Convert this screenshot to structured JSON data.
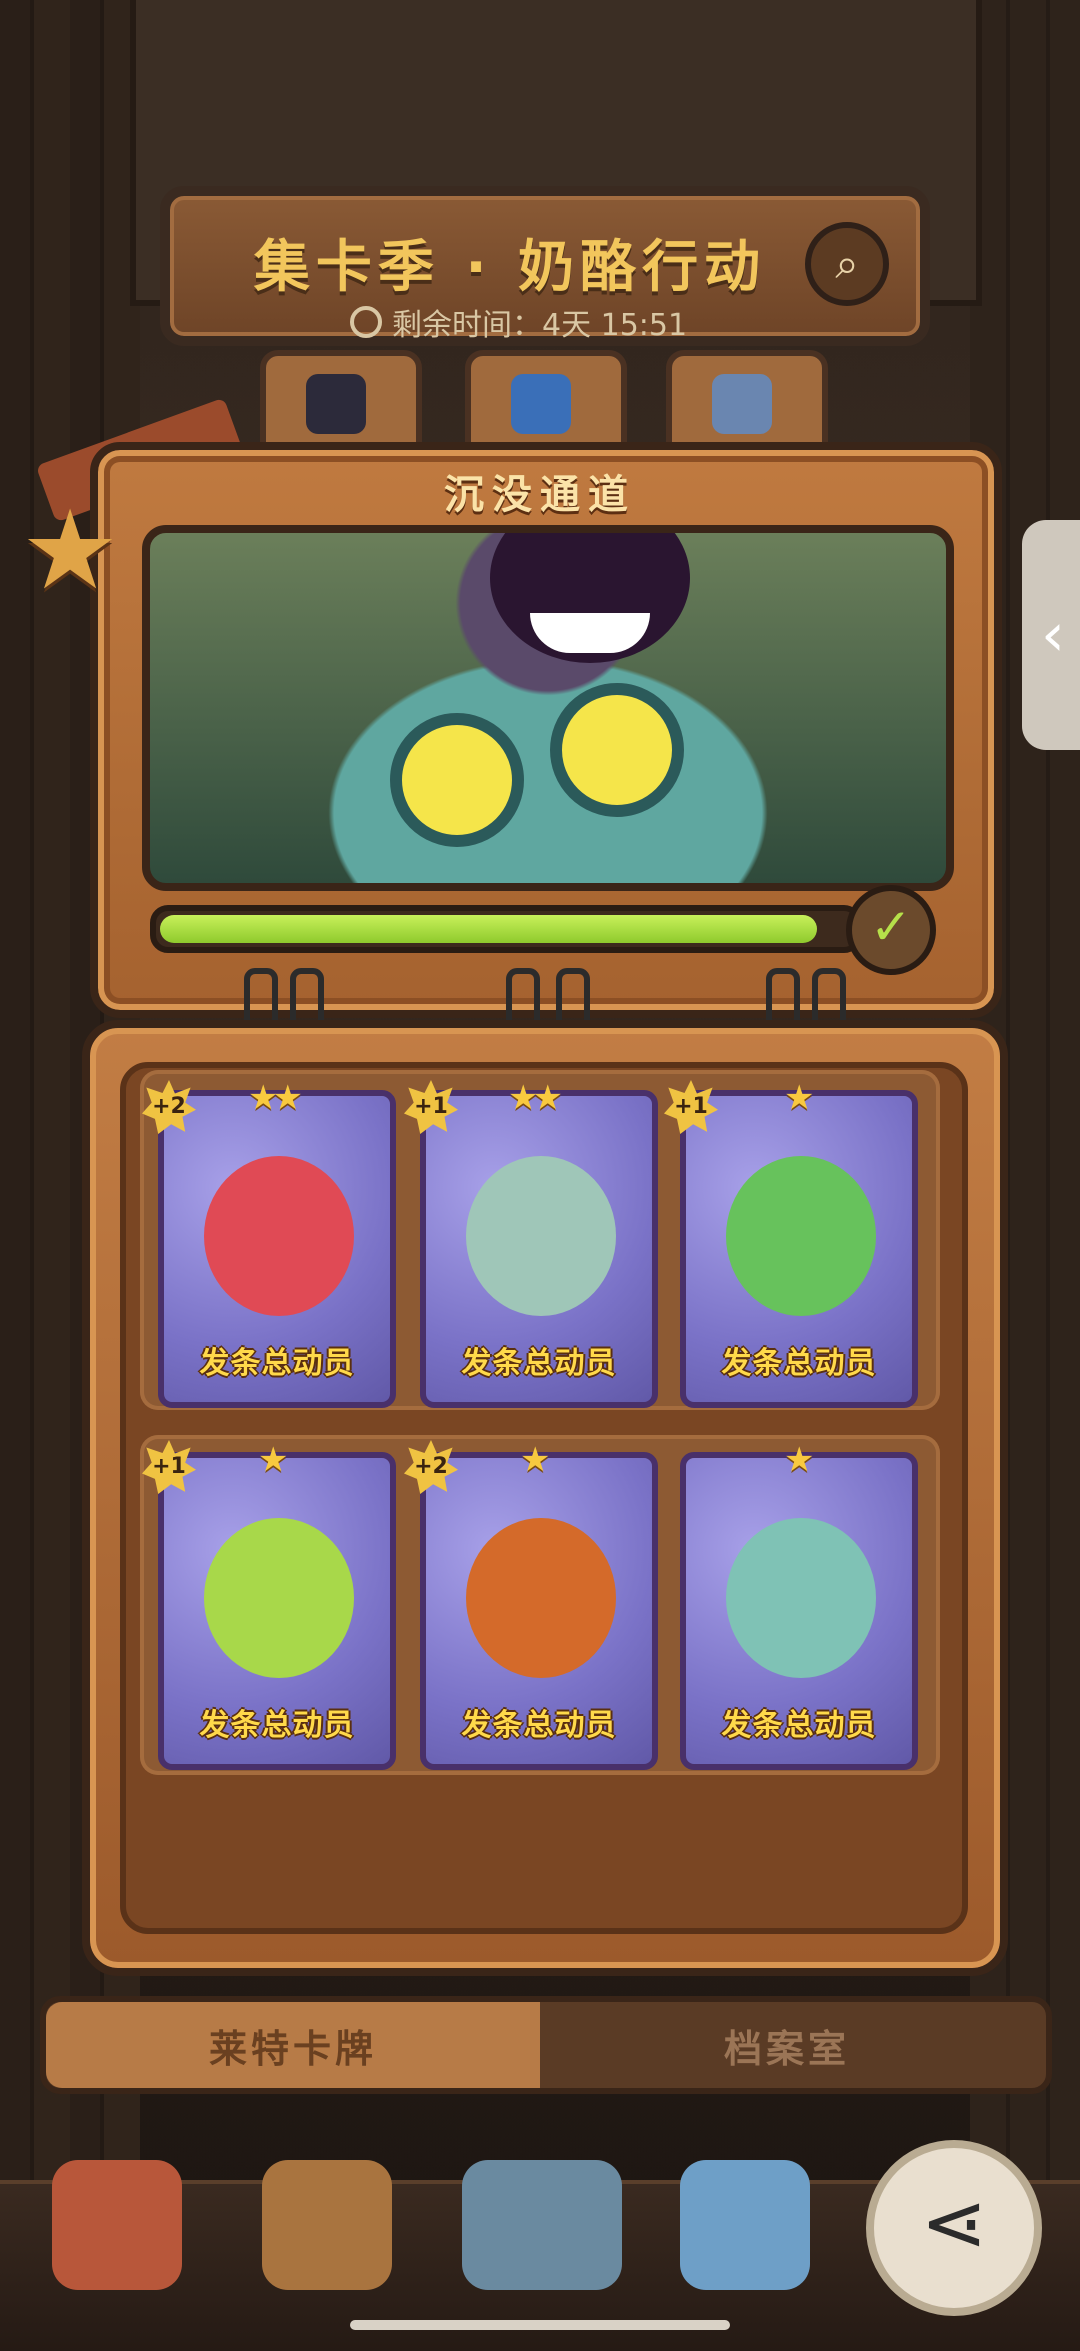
{
  "header": {
    "title": "集卡季 · 奶酪行动",
    "search_icon": "magnifier-icon",
    "timer_label": "剩余时间：4天 15:51"
  },
  "chapter": {
    "title": "沉没通道",
    "progress_fraction": 0.95,
    "complete_icon": "check-icon"
  },
  "cards": [
    {
      "dup": "+2",
      "stars": "★★",
      "caption": "发条总动员",
      "color": "#e04a55"
    },
    {
      "dup": "+1",
      "stars": "★★",
      "caption": "发条总动员",
      "color": "#9fc6b8"
    },
    {
      "dup": "+1",
      "stars": "★",
      "caption": "发条总动员",
      "color": "#67c25c"
    },
    {
      "dup": "+1",
      "stars": "★",
      "caption": "发条总动员",
      "color": "#a8d84a"
    },
    {
      "dup": "+2",
      "stars": "★",
      "caption": "发条总动员",
      "color": "#d46a2a"
    },
    {
      "dup": "",
      "stars": "★",
      "caption": "发条总动员",
      "color": "#7fc2b5"
    }
  ],
  "tabs": {
    "cards_tab": "莱特卡牌",
    "archive_tab": "档案室"
  },
  "side_handle": "‹",
  "share_icon": "share-icon",
  "colors": {
    "accent_gold": "#f2c65c",
    "progress_green": "#a6e03c",
    "card_purple": "#7a72c7"
  }
}
